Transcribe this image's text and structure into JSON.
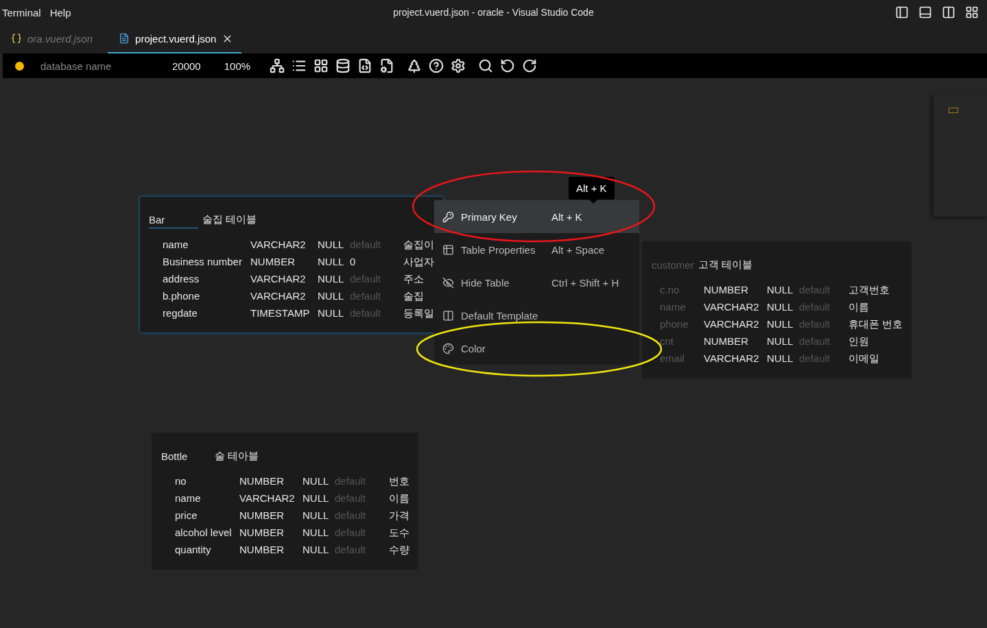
{
  "menu_bar": [
    "Terminal",
    "Help"
  ],
  "window": {
    "title": "project.vuerd.json - oracle - Visual Studio Code"
  },
  "tabs": [
    {
      "label": "ora.vuerd.json",
      "selected": false,
      "kind": "json"
    },
    {
      "label": "project.vuerd.json",
      "selected": true,
      "kind": "file"
    }
  ],
  "toolbar": {
    "database_name": {
      "placeholder": "database name"
    },
    "canvas_size": "20000",
    "zoom": "100%"
  },
  "tables": [
    {
      "name": "Bar",
      "comment": "술집 테이블",
      "selected": true,
      "dimmed": false,
      "columns": [
        {
          "name": "name",
          "type": "VARCHAR2",
          "null": "NULL",
          "default_placeholder": "default",
          "comment": "술집이"
        },
        {
          "name": "Business number",
          "type": "NUMBER",
          "null": "NULL",
          "default": "0",
          "comment": "사업자"
        },
        {
          "name": "address",
          "type": "VARCHAR2",
          "null": "NULL",
          "default_placeholder": "default",
          "comment": "주소"
        },
        {
          "name": "b.phone",
          "type": "VARCHAR2",
          "null": "NULL",
          "default_placeholder": "default",
          "comment": "술집"
        },
        {
          "name": "regdate",
          "type": "TIMESTAMP",
          "null": "NULL",
          "default_placeholder": "default",
          "comment": "등록일"
        }
      ]
    },
    {
      "name": "customer",
      "comment": "고객 테이블",
      "selected": false,
      "dimmed": true,
      "columns": [
        {
          "name": "c.no",
          "type": "NUMBER",
          "null": "NULL",
          "default_placeholder": "default",
          "comment": "고객번호"
        },
        {
          "name": "name",
          "type": "VARCHAR2",
          "null": "NULL",
          "default_placeholder": "default",
          "comment": "이름"
        },
        {
          "name": "phone",
          "type": "VARCHAR2",
          "null": "NULL",
          "default_placeholder": "default",
          "comment": "휴대폰 번호"
        },
        {
          "name": "cnt",
          "type": "NUMBER",
          "null": "NULL",
          "default_placeholder": "default",
          "comment": "인원"
        },
        {
          "name": "email",
          "type": "VARCHAR2",
          "null": "NULL",
          "default_placeholder": "default",
          "comment": "이메일"
        }
      ]
    },
    {
      "name": "Bottle",
      "comment": "술 테아블",
      "selected": false,
      "dimmed": false,
      "columns": [
        {
          "name": "no",
          "type": "NUMBER",
          "null": "NULL",
          "default_placeholder": "default",
          "comment": "번호"
        },
        {
          "name": "name",
          "type": "VARCHAR2",
          "null": "NULL",
          "default_placeholder": "default",
          "comment": "이름"
        },
        {
          "name": "price",
          "type": "NUMBER",
          "null": "NULL",
          "default_placeholder": "default",
          "comment": "가격"
        },
        {
          "name": "alcohol level",
          "type": "NUMBER",
          "null": "NULL",
          "default_placeholder": "default",
          "comment": "도수"
        },
        {
          "name": "quantity",
          "type": "NUMBER",
          "null": "NULL",
          "default_placeholder": "default",
          "comment": "수량"
        }
      ]
    }
  ],
  "context_menu": {
    "tooltip": "Alt + K",
    "items": [
      {
        "label": "Primary Key",
        "shortcut": "Alt + K",
        "kind": "key",
        "hovered": true
      },
      {
        "label": "Table Properties",
        "shortcut": "Alt + Space",
        "kind": "table",
        "hovered": false
      },
      {
        "label": "Hide Table",
        "shortcut": "Ctrl + Shift + H",
        "kind": "hide",
        "hovered": false
      },
      {
        "label": "Default Template",
        "kind": "template",
        "hovered": false
      },
      {
        "label": "Color",
        "kind": "palette",
        "hovered": false
      }
    ]
  },
  "annotations": [
    {
      "kind": "ellipse",
      "color": "#e8161b"
    },
    {
      "kind": "ellipse",
      "color": "#f0e60f"
    }
  ]
}
